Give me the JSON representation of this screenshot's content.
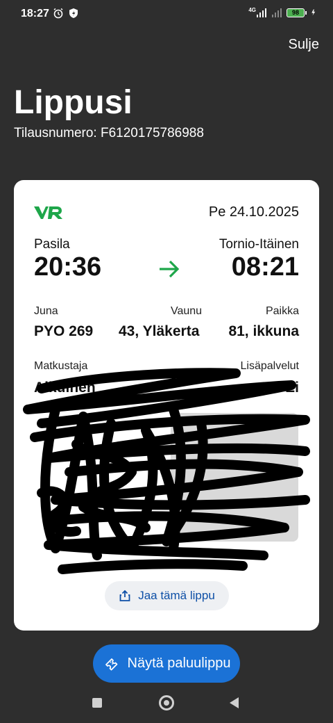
{
  "status_bar": {
    "time": "18:27",
    "network_label": "4G",
    "battery_level": "98",
    "icons": [
      "alarm-icon",
      "shield-icon",
      "signal-icon",
      "signal-icon",
      "battery-icon",
      "charging-icon"
    ]
  },
  "header": {
    "close_label": "Sulje",
    "title": "Lippusi",
    "order_label": "Tilausnumero:",
    "order_number": "F6120175786988"
  },
  "ticket": {
    "brand_color": "#1ea64a",
    "date": "Pe 24.10.2025",
    "from_station": "Pasila",
    "to_station": "Tornio-Itäinen",
    "departure_time": "20:36",
    "arrival_time": "08:21",
    "train_label": "Juna",
    "train_value": "PYO 269",
    "car_label": "Vaunu",
    "car_value": "43, Yläkerta",
    "seat_label": "Paikka",
    "seat_value": "81, ikkuna",
    "passenger_label": "Matkustaja",
    "passenger_value": "Aikuinen",
    "extras_label": "Lisäpalvelut",
    "extras_value": "Ei",
    "share_label": "Jaa tämä lippu"
  },
  "footer": {
    "return_ticket_label": "Näytä paluulippu",
    "accent_color": "#1b72d6"
  }
}
